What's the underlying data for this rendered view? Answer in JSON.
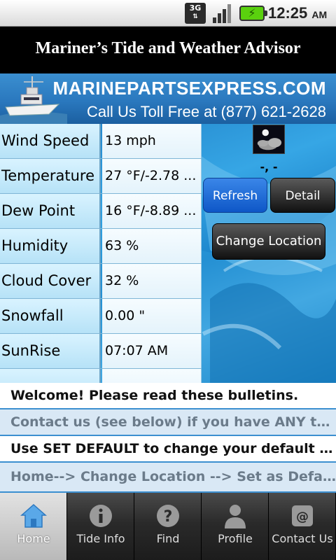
{
  "status_bar": {
    "network": "3G",
    "time": "12:25",
    "ampm": "AM"
  },
  "app": {
    "title": "Mariner’s Tide and Weather Advisor"
  },
  "banner": {
    "site": "MARINEPARTSEXPRESS.COM",
    "phone": "Call Us Toll Free at (877) 621-2628"
  },
  "weather": {
    "rows": [
      {
        "label": "Wind Speed",
        "value": "13 mph"
      },
      {
        "label": "Temperature",
        "value": "27 °F/-2.78 ..."
      },
      {
        "label": "Dew Point",
        "value": "16 °F/-8.89 ..."
      },
      {
        "label": "Humidity",
        "value": "63 %"
      },
      {
        "label": "Cloud Cover",
        "value": "32 %"
      },
      {
        "label": "Snowfall",
        "value": "0.00 \""
      },
      {
        "label": "SunRise",
        "value": "07:07 AM"
      }
    ],
    "coords": "-, -"
  },
  "buttons": {
    "refresh": "Refresh",
    "detail": "Detail",
    "change_location": "Change Location"
  },
  "bulletins": [
    "Welcome! Please read these bulletins.",
    "Contact us (see below) if you have ANY troubl...",
    "Use SET DEFAULT to change your default loc...",
    "Home--> Change Location --> Set as Default.  B..."
  ],
  "tabs": [
    {
      "label": "Home",
      "icon": "house-icon",
      "active": true
    },
    {
      "label": "Tide Info",
      "icon": "info-icon",
      "active": false
    },
    {
      "label": "Find",
      "icon": "question-icon",
      "active": false
    },
    {
      "label": "Profile",
      "icon": "person-icon",
      "active": false
    },
    {
      "label": "Contact Us",
      "icon": "at-sign-icon",
      "active": false
    }
  ],
  "colors": {
    "accent_blue": "#1e7ec5",
    "refresh_blue": "#0e57c7",
    "button_dark": "#111111",
    "bulletin_alt": "#d9e8f5"
  }
}
